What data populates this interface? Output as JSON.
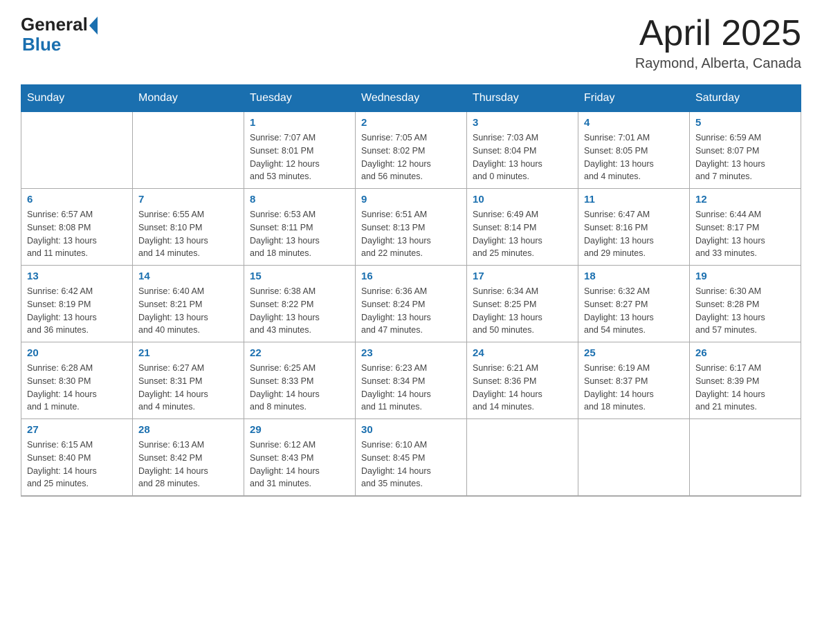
{
  "header": {
    "logo_general": "General",
    "logo_blue": "Blue",
    "title": "April 2025",
    "subtitle": "Raymond, Alberta, Canada"
  },
  "calendar": {
    "headers": [
      "Sunday",
      "Monday",
      "Tuesday",
      "Wednesday",
      "Thursday",
      "Friday",
      "Saturday"
    ],
    "weeks": [
      [
        {
          "day": "",
          "info": ""
        },
        {
          "day": "",
          "info": ""
        },
        {
          "day": "1",
          "info": "Sunrise: 7:07 AM\nSunset: 8:01 PM\nDaylight: 12 hours\nand 53 minutes."
        },
        {
          "day": "2",
          "info": "Sunrise: 7:05 AM\nSunset: 8:02 PM\nDaylight: 12 hours\nand 56 minutes."
        },
        {
          "day": "3",
          "info": "Sunrise: 7:03 AM\nSunset: 8:04 PM\nDaylight: 13 hours\nand 0 minutes."
        },
        {
          "day": "4",
          "info": "Sunrise: 7:01 AM\nSunset: 8:05 PM\nDaylight: 13 hours\nand 4 minutes."
        },
        {
          "day": "5",
          "info": "Sunrise: 6:59 AM\nSunset: 8:07 PM\nDaylight: 13 hours\nand 7 minutes."
        }
      ],
      [
        {
          "day": "6",
          "info": "Sunrise: 6:57 AM\nSunset: 8:08 PM\nDaylight: 13 hours\nand 11 minutes."
        },
        {
          "day": "7",
          "info": "Sunrise: 6:55 AM\nSunset: 8:10 PM\nDaylight: 13 hours\nand 14 minutes."
        },
        {
          "day": "8",
          "info": "Sunrise: 6:53 AM\nSunset: 8:11 PM\nDaylight: 13 hours\nand 18 minutes."
        },
        {
          "day": "9",
          "info": "Sunrise: 6:51 AM\nSunset: 8:13 PM\nDaylight: 13 hours\nand 22 minutes."
        },
        {
          "day": "10",
          "info": "Sunrise: 6:49 AM\nSunset: 8:14 PM\nDaylight: 13 hours\nand 25 minutes."
        },
        {
          "day": "11",
          "info": "Sunrise: 6:47 AM\nSunset: 8:16 PM\nDaylight: 13 hours\nand 29 minutes."
        },
        {
          "day": "12",
          "info": "Sunrise: 6:44 AM\nSunset: 8:17 PM\nDaylight: 13 hours\nand 33 minutes."
        }
      ],
      [
        {
          "day": "13",
          "info": "Sunrise: 6:42 AM\nSunset: 8:19 PM\nDaylight: 13 hours\nand 36 minutes."
        },
        {
          "day": "14",
          "info": "Sunrise: 6:40 AM\nSunset: 8:21 PM\nDaylight: 13 hours\nand 40 minutes."
        },
        {
          "day": "15",
          "info": "Sunrise: 6:38 AM\nSunset: 8:22 PM\nDaylight: 13 hours\nand 43 minutes."
        },
        {
          "day": "16",
          "info": "Sunrise: 6:36 AM\nSunset: 8:24 PM\nDaylight: 13 hours\nand 47 minutes."
        },
        {
          "day": "17",
          "info": "Sunrise: 6:34 AM\nSunset: 8:25 PM\nDaylight: 13 hours\nand 50 minutes."
        },
        {
          "day": "18",
          "info": "Sunrise: 6:32 AM\nSunset: 8:27 PM\nDaylight: 13 hours\nand 54 minutes."
        },
        {
          "day": "19",
          "info": "Sunrise: 6:30 AM\nSunset: 8:28 PM\nDaylight: 13 hours\nand 57 minutes."
        }
      ],
      [
        {
          "day": "20",
          "info": "Sunrise: 6:28 AM\nSunset: 8:30 PM\nDaylight: 14 hours\nand 1 minute."
        },
        {
          "day": "21",
          "info": "Sunrise: 6:27 AM\nSunset: 8:31 PM\nDaylight: 14 hours\nand 4 minutes."
        },
        {
          "day": "22",
          "info": "Sunrise: 6:25 AM\nSunset: 8:33 PM\nDaylight: 14 hours\nand 8 minutes."
        },
        {
          "day": "23",
          "info": "Sunrise: 6:23 AM\nSunset: 8:34 PM\nDaylight: 14 hours\nand 11 minutes."
        },
        {
          "day": "24",
          "info": "Sunrise: 6:21 AM\nSunset: 8:36 PM\nDaylight: 14 hours\nand 14 minutes."
        },
        {
          "day": "25",
          "info": "Sunrise: 6:19 AM\nSunset: 8:37 PM\nDaylight: 14 hours\nand 18 minutes."
        },
        {
          "day": "26",
          "info": "Sunrise: 6:17 AM\nSunset: 8:39 PM\nDaylight: 14 hours\nand 21 minutes."
        }
      ],
      [
        {
          "day": "27",
          "info": "Sunrise: 6:15 AM\nSunset: 8:40 PM\nDaylight: 14 hours\nand 25 minutes."
        },
        {
          "day": "28",
          "info": "Sunrise: 6:13 AM\nSunset: 8:42 PM\nDaylight: 14 hours\nand 28 minutes."
        },
        {
          "day": "29",
          "info": "Sunrise: 6:12 AM\nSunset: 8:43 PM\nDaylight: 14 hours\nand 31 minutes."
        },
        {
          "day": "30",
          "info": "Sunrise: 6:10 AM\nSunset: 8:45 PM\nDaylight: 14 hours\nand 35 minutes."
        },
        {
          "day": "",
          "info": ""
        },
        {
          "day": "",
          "info": ""
        },
        {
          "day": "",
          "info": ""
        }
      ]
    ]
  }
}
